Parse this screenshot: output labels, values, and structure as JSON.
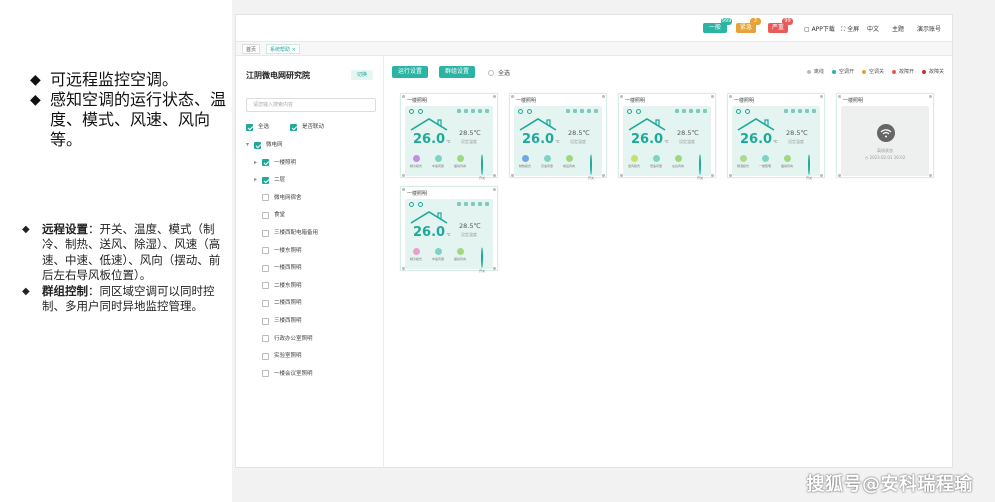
{
  "slide": {
    "bullets_top": [
      "可远程监控空调。",
      "感知空调的运行状态、温度、模式、风速、风向等。"
    ],
    "bullets_bottom": [
      {
        "bold": "远程设置",
        "text": "：开关、温度、模式（制冷、制热、送风、除湿）、风速（高速、中速、低速）、风向（摆动、前后左右导风板位置）。"
      },
      {
        "bold": "群组控制",
        "text": "：同区域空调可以同时控制、多用户同时异地监控管理。"
      }
    ],
    "watermark": "搜狐号@安科瑞程瑜"
  },
  "app": {
    "header": {
      "badges": [
        {
          "label": "一般",
          "count": "999",
          "color": "#2bb3a3"
        },
        {
          "label": "紧急",
          "count": "2",
          "color": "#e5a33a"
        },
        {
          "label": "严重",
          "count": "99",
          "color": "#e85b5b"
        }
      ],
      "links": [
        "APP下载",
        "全屏",
        "中文",
        "主题",
        "演示账号"
      ]
    },
    "tabs": [
      "首页",
      "系统帮助"
    ],
    "sidebar": {
      "title": "江阴微电网研究院",
      "switch_label": "切换",
      "search_placeholder": "请您输入搜索内容",
      "select_all": "全选",
      "cascade": "是否联动",
      "tree": [
        {
          "label": "微电网",
          "checked": true,
          "level": 0,
          "arrow": "▾"
        },
        {
          "label": "一楼照明",
          "checked": true,
          "level": 1,
          "arrow": "▸"
        },
        {
          "label": "二层",
          "checked": true,
          "level": 1,
          "arrow": "▸"
        },
        {
          "label": "微电网宿舍",
          "checked": false,
          "level": 1,
          "arrow": ""
        },
        {
          "label": "食堂",
          "checked": false,
          "level": 1,
          "arrow": ""
        },
        {
          "label": "三楼西配电箱备用",
          "checked": false,
          "level": 1,
          "arrow": ""
        },
        {
          "label": "一楼东照明",
          "checked": false,
          "level": 1,
          "arrow": ""
        },
        {
          "label": "一楼西照明",
          "checked": false,
          "level": 1,
          "arrow": ""
        },
        {
          "label": "二楼东照明",
          "checked": false,
          "level": 1,
          "arrow": ""
        },
        {
          "label": "二楼西照明",
          "checked": false,
          "level": 1,
          "arrow": ""
        },
        {
          "label": "三楼西照明",
          "checked": false,
          "level": 1,
          "arrow": ""
        },
        {
          "label": "行政办公室照明",
          "checked": false,
          "level": 1,
          "arrow": ""
        },
        {
          "label": "实验室照明",
          "checked": false,
          "level": 1,
          "arrow": ""
        },
        {
          "label": "一楼会议室照明",
          "checked": false,
          "level": 1,
          "arrow": ""
        }
      ]
    },
    "toolbar": {
      "run_settings": "运行设置",
      "group_settings": "群组设置",
      "select_all": "全选"
    },
    "legend": [
      {
        "label": "离线",
        "color": "#bbbbbb"
      },
      {
        "label": "空调开",
        "color": "#2bb3a3"
      },
      {
        "label": "空调关",
        "color": "#e5a33a"
      },
      {
        "label": "故障开",
        "color": "#e85b5b"
      },
      {
        "label": "故障关",
        "color": "#c0392b"
      }
    ],
    "cards": [
      {
        "name": "一楼照明",
        "temp": "26.0",
        "unit": "℃",
        "set": "28.5℃",
        "set_label": "设定温度",
        "modes": [
          "制冷模式",
          "中速风量",
          "摆动风向",
          "开关"
        ],
        "mode_colors": [
          "#c48be3",
          "#7fd3c4",
          "#9fd87d"
        ],
        "offline": false
      },
      {
        "name": "一楼照明",
        "temp": "26.0",
        "unit": "℃",
        "set": "28.5℃",
        "set_label": "设定温度",
        "modes": [
          "制热模式",
          "高速风量",
          "前后风向",
          "开关"
        ],
        "mode_colors": [
          "#6fa8e8",
          "#7fd3c4",
          "#9fd87d"
        ],
        "offline": false
      },
      {
        "name": "一楼照明",
        "temp": "26.0",
        "unit": "℃",
        "set": "28.5℃",
        "set_label": "设定温度",
        "modes": [
          "送风模式",
          "低速风量",
          "左右风向",
          "开关"
        ],
        "mode_colors": [
          "#c8e06a",
          "#7fd3c4",
          "#9fd87d"
        ],
        "offline": false
      },
      {
        "name": "一楼照明",
        "temp": "26.0",
        "unit": "℃",
        "set": "28.5℃",
        "set_label": "设定温度",
        "modes": [
          "除湿模式",
          "一楼照明",
          "摆动风向",
          "开关"
        ],
        "mode_colors": [
          "#a9dc8a",
          "#7fd3c4",
          "#9fd87d"
        ],
        "offline": false
      },
      {
        "name": "一楼照明",
        "offline": true,
        "offline_text": "离线状态",
        "offline_date": "2023.02.01 16:02"
      },
      {
        "name": "一楼照明",
        "temp": "26.0",
        "unit": "℃",
        "set": "28.5℃",
        "set_label": "设定温度",
        "modes": [
          "制冷模式",
          "中速风量",
          "摆动风向",
          "开关"
        ],
        "mode_colors": [
          "#e8a0c8",
          "#7fd3c4",
          "#9fd87d"
        ],
        "offline": false
      }
    ]
  }
}
